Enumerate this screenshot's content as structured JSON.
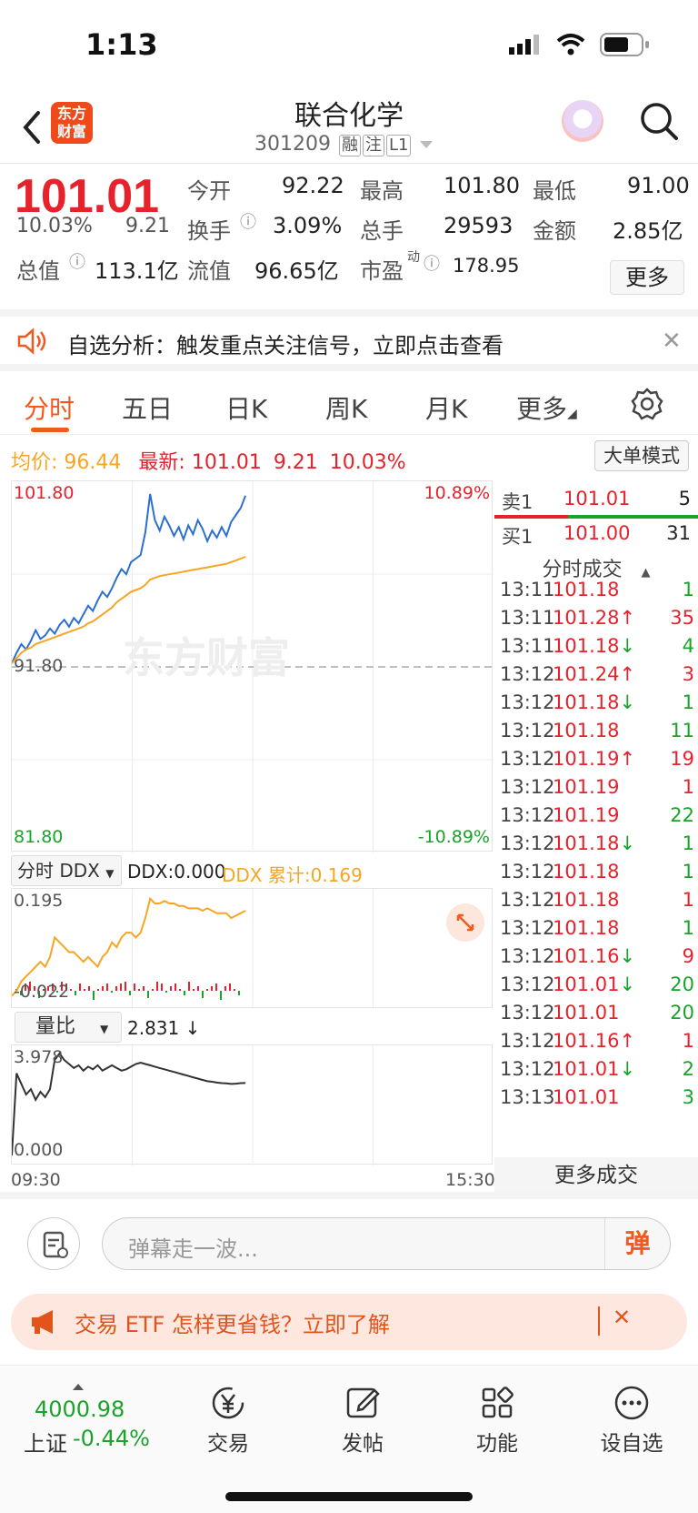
{
  "status_bar": {
    "time": "1:13"
  },
  "nav": {
    "title": "联合化学",
    "code": "301209",
    "tags": [
      "融",
      "注",
      "L1"
    ],
    "logo_text": "东方财富"
  },
  "quote": {
    "price": "101.01",
    "change_pct": "10.03%",
    "change": "9.21",
    "open_label": "今开",
    "open": "92.22",
    "high_label": "最高",
    "high": "101.80",
    "low_label": "最低",
    "low": "91.00",
    "turnover_label": "换手",
    "turnover": "3.09%",
    "volume_label": "总手",
    "volume": "29593",
    "amount_label": "金额",
    "amount": "2.85亿",
    "mcap_label": "总值",
    "mcap": "113.1亿",
    "float_label": "流值",
    "float_cap": "96.65亿",
    "pe_label": "市盈",
    "pe_sup": "动",
    "pe": "178.95",
    "more": "更多"
  },
  "notice": {
    "text": "自选分析：触发重点关注信号，立即点击查看"
  },
  "tabs": [
    "分时",
    "五日",
    "日K",
    "周K",
    "月K",
    "更多"
  ],
  "info": {
    "avg_label": "均价:",
    "avg": "96.44",
    "latest_label": "最新:",
    "latest": "101.01",
    "change": "9.21",
    "pct": "10.03%",
    "big_mode": "大单模式"
  },
  "chart_labels": {
    "y_top": "101.80",
    "y_mid": "91.80",
    "y_bot": "81.80",
    "pct_top": "10.89%",
    "pct_bot": "-10.89%",
    "watermark": "东方财富",
    "t_start": "09:30",
    "t_end": "15:30"
  },
  "ddx": {
    "selector": "分时 DDX",
    "value_text": "DDX:0.000",
    "cum_text": "DDX 累计:0.169",
    "y_top": "0.195",
    "y_bot": "-0.022"
  },
  "volume_ratio": {
    "selector": "量比",
    "value_text": "2.831 ↓",
    "y_top": "3.978",
    "y_bot": "0.000"
  },
  "orderbook": {
    "sell": {
      "label": "卖1",
      "price": "101.01",
      "qty": "5"
    },
    "buy": {
      "label": "买1",
      "price": "101.00",
      "qty": "31"
    }
  },
  "trades_title": "分时成交",
  "trades": [
    {
      "time": "13:11",
      "price": "101.18",
      "arrow": "",
      "qty": "1",
      "pc": "red",
      "qc": "green"
    },
    {
      "time": "13:11",
      "price": "101.28",
      "arrow": "↑",
      "qty": "35",
      "pc": "red",
      "qc": "red"
    },
    {
      "time": "13:11",
      "price": "101.18",
      "arrow": "↓",
      "qty": "4",
      "pc": "red",
      "qc": "green"
    },
    {
      "time": "13:12",
      "price": "101.24",
      "arrow": "↑",
      "qty": "3",
      "pc": "red",
      "qc": "red"
    },
    {
      "time": "13:12",
      "price": "101.18",
      "arrow": "↓",
      "qty": "1",
      "pc": "red",
      "qc": "green"
    },
    {
      "time": "13:12",
      "price": "101.18",
      "arrow": "",
      "qty": "11",
      "pc": "red",
      "qc": "green"
    },
    {
      "time": "13:12",
      "price": "101.19",
      "arrow": "↑",
      "qty": "19",
      "pc": "red",
      "qc": "red"
    },
    {
      "time": "13:12",
      "price": "101.19",
      "arrow": "",
      "qty": "1",
      "pc": "red",
      "qc": "red"
    },
    {
      "time": "13:12",
      "price": "101.19",
      "arrow": "",
      "qty": "22",
      "pc": "red",
      "qc": "green"
    },
    {
      "time": "13:12",
      "price": "101.18",
      "arrow": "↓",
      "qty": "1",
      "pc": "red",
      "qc": "green"
    },
    {
      "time": "13:12",
      "price": "101.18",
      "arrow": "",
      "qty": "1",
      "pc": "red",
      "qc": "green"
    },
    {
      "time": "13:12",
      "price": "101.18",
      "arrow": "",
      "qty": "1",
      "pc": "red",
      "qc": "red"
    },
    {
      "time": "13:12",
      "price": "101.18",
      "arrow": "",
      "qty": "1",
      "pc": "red",
      "qc": "green"
    },
    {
      "time": "13:12",
      "price": "101.16",
      "arrow": "↓",
      "qty": "9",
      "pc": "red",
      "qc": "red"
    },
    {
      "time": "13:12",
      "price": "101.01",
      "arrow": "↓",
      "qty": "20",
      "pc": "red",
      "qc": "green"
    },
    {
      "time": "13:12",
      "price": "101.01",
      "arrow": "",
      "qty": "20",
      "pc": "red",
      "qc": "green"
    },
    {
      "time": "13:12",
      "price": "101.16",
      "arrow": "↑",
      "qty": "1",
      "pc": "red",
      "qc": "red"
    },
    {
      "time": "13:12",
      "price": "101.01",
      "arrow": "↓",
      "qty": "2",
      "pc": "red",
      "qc": "green"
    },
    {
      "time": "13:13",
      "price": "101.01",
      "arrow": "",
      "qty": "3",
      "pc": "red",
      "qc": "green"
    }
  ],
  "more_trades": "更多成交",
  "danmu": {
    "placeholder": "弹幕走一波...",
    "send": "弹"
  },
  "ad": {
    "text": "交易 ETF 怎样更省钱？立即了解"
  },
  "bottom_nav": {
    "index_value": "4000.98",
    "index_name": "上证",
    "index_change": "-0.44%",
    "items": [
      {
        "label": "交易",
        "icon": "yuan-exchange-icon"
      },
      {
        "label": "发帖",
        "icon": "edit-icon"
      },
      {
        "label": "功能",
        "icon": "grid-icon"
      },
      {
        "label": "设自选",
        "icon": "more-dots-icon"
      }
    ]
  },
  "colors": {
    "up": "#e6222c",
    "down": "#1aa32a",
    "avg": "#f6a623",
    "accent": "#f05a1e",
    "price_line": "#2c6fd1"
  },
  "chart_data": [
    {
      "type": "line",
      "title": "",
      "xlabel": "",
      "ylabel": "",
      "ylim": [
        81.8,
        101.8
      ],
      "x_range": [
        "09:30",
        "15:30"
      ],
      "series": [
        {
          "values": [
            92.0,
            92.6,
            93.1,
            92.8,
            93.3,
            93.9,
            93.4,
            93.6,
            94.0,
            93.7,
            94.2,
            94.5,
            94.1,
            94.6,
            94.3,
            94.8,
            95.3,
            95.0,
            95.6,
            96.1,
            95.8,
            96.3,
            96.9,
            97.4,
            97.1,
            97.8,
            98.0,
            98.2,
            99.5,
            101.7,
            100.2,
            99.6,
            100.4,
            99.9,
            99.3,
            99.8,
            99.1,
            99.9,
            99.4,
            100.2,
            99.7,
            99.0,
            99.6,
            99.2,
            99.8,
            99.3,
            100.1,
            100.5,
            100.9,
            101.6
          ]
        },
        {
          "values": [
            92.0,
            92.3,
            92.6,
            92.8,
            92.9,
            93.1,
            93.2,
            93.3,
            93.4,
            93.5,
            93.6,
            93.7,
            93.8,
            93.9,
            94.0,
            94.1,
            94.3,
            94.4,
            94.6,
            94.8,
            95.0,
            95.2,
            95.5,
            95.7,
            95.9,
            96.1,
            96.2,
            96.3,
            96.5,
            96.8,
            96.9,
            97.0,
            97.05,
            97.1,
            97.15,
            97.2,
            97.25,
            97.3,
            97.35,
            97.4,
            97.45,
            97.5,
            97.55,
            97.6,
            97.65,
            97.7,
            97.8,
            97.9,
            98.0,
            98.1
          ]
        }
      ]
    },
    {
      "type": "line",
      "title": "",
      "ylim": [
        -0.022,
        0.195
      ],
      "series": [
        {
          "values": [
            -0.01,
            0.0,
            0.02,
            0.03,
            0.04,
            0.05,
            0.06,
            0.05,
            0.07,
            0.11,
            0.1,
            0.09,
            0.08,
            0.08,
            0.07,
            0.06,
            0.07,
            0.06,
            0.05,
            0.07,
            0.08,
            0.1,
            0.09,
            0.11,
            0.12,
            0.12,
            0.11,
            0.12,
            0.15,
            0.19,
            0.18,
            0.18,
            0.185,
            0.18,
            0.18,
            0.175,
            0.175,
            0.17,
            0.17,
            0.17,
            0.165,
            0.17,
            0.165,
            0.16,
            0.16,
            0.16,
            0.15,
            0.155,
            0.16,
            0.165
          ]
        }
      ]
    },
    {
      "type": "line",
      "title": "",
      "ylim": [
        0.0,
        3.978
      ],
      "series": [
        {
          "values": [
            0.1,
            3.2,
            2.8,
            2.4,
            2.6,
            2.2,
            2.5,
            2.3,
            2.6,
            3.7,
            3.95,
            3.7,
            3.55,
            3.4,
            3.5,
            3.3,
            3.45,
            3.35,
            3.5,
            3.3,
            3.4,
            3.5,
            3.4,
            3.3,
            3.35,
            3.45,
            3.55,
            3.6,
            3.55,
            3.5,
            3.45,
            3.4,
            3.35,
            3.3,
            3.25,
            3.2,
            3.15,
            3.1,
            3.05,
            3.0,
            2.95,
            2.9,
            2.88,
            2.85,
            2.83,
            2.82,
            2.8,
            2.81,
            2.83,
            2.831
          ]
        }
      ]
    }
  ]
}
